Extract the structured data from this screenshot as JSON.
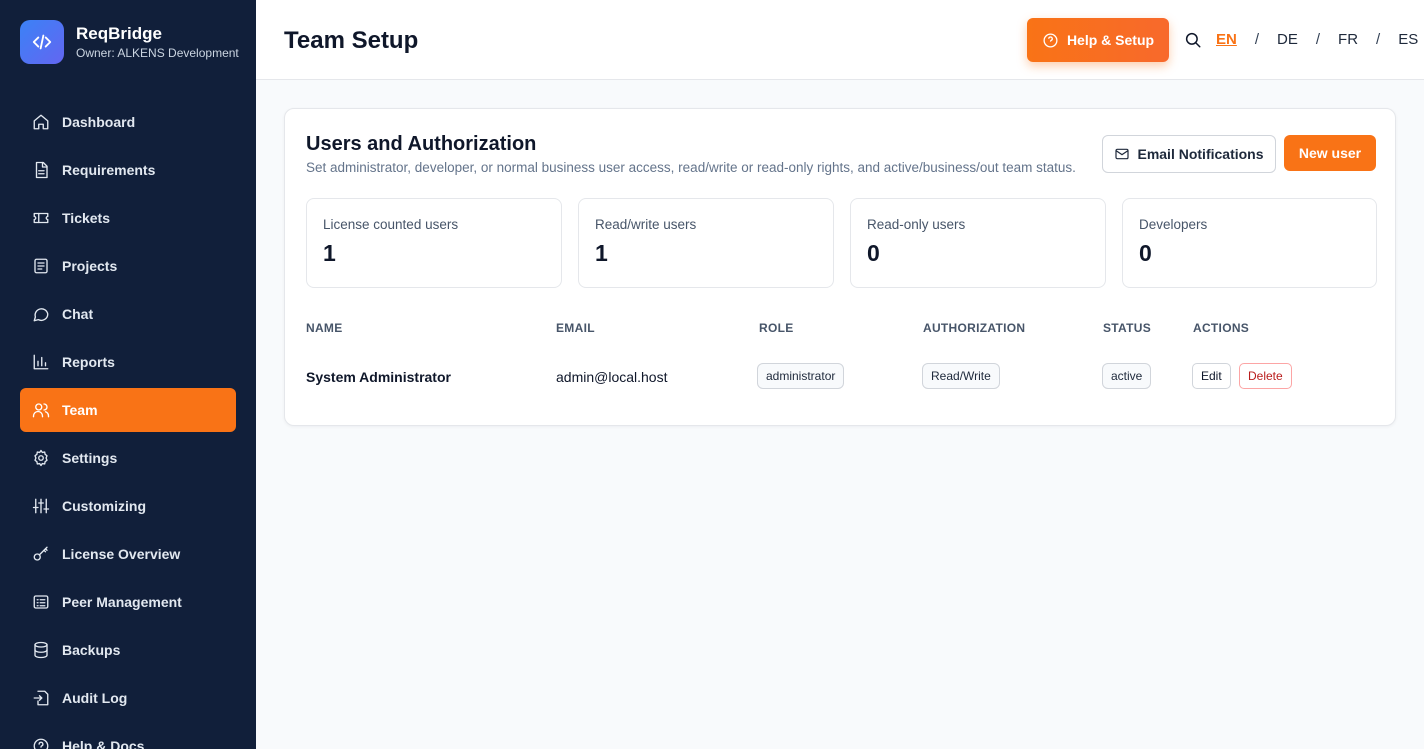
{
  "brand": {
    "name": "ReqBridge",
    "owner": "Owner: ALKENS Development",
    "logo_icon": "code-icon"
  },
  "sidebar": {
    "items": [
      {
        "label": "Dashboard",
        "icon": "home-icon",
        "active": false
      },
      {
        "label": "Requirements",
        "icon": "document-icon",
        "active": false
      },
      {
        "label": "Tickets",
        "icon": "ticket-icon",
        "active": false
      },
      {
        "label": "Projects",
        "icon": "project-icon",
        "active": false
      },
      {
        "label": "Chat",
        "icon": "chat-icon",
        "active": false
      },
      {
        "label": "Reports",
        "icon": "bar-chart-icon",
        "active": false
      },
      {
        "label": "Team",
        "icon": "users-icon",
        "active": true
      },
      {
        "label": "Settings",
        "icon": "gear-icon",
        "active": false
      },
      {
        "label": "Customizing",
        "icon": "sliders-icon",
        "active": false
      },
      {
        "label": "License Overview",
        "icon": "key-icon",
        "active": false
      },
      {
        "label": "Peer Management",
        "icon": "list-icon",
        "active": false
      },
      {
        "label": "Backups",
        "icon": "database-icon",
        "active": false
      },
      {
        "label": "Audit Log",
        "icon": "log-in-icon",
        "active": false
      },
      {
        "label": "Help & Docs",
        "icon": "help-circle-icon",
        "active": false
      }
    ]
  },
  "header": {
    "title": "Team Setup",
    "help_label": "Help & Setup",
    "languages": [
      "EN",
      "DE",
      "FR",
      "ES"
    ],
    "active_language": "EN",
    "separator": "/"
  },
  "card": {
    "title": "Users and Authorization",
    "subtitle": "Set administrator, developer, or normal business user access, read/write or read-only rights, and active/business/out team status.",
    "email_button": "Email Notifications",
    "new_button": "New user",
    "stats": [
      {
        "label": "License counted users",
        "value": "1"
      },
      {
        "label": "Read/write users",
        "value": "1"
      },
      {
        "label": "Read-only users",
        "value": "0"
      },
      {
        "label": "Developers",
        "value": "0"
      }
    ],
    "table": {
      "headers": [
        "NAME",
        "EMAIL",
        "ROLE",
        "AUTHORIZATION",
        "STATUS",
        "ACTIONS"
      ],
      "rows": [
        {
          "name": "System Administrator",
          "email": "admin@local.host",
          "role": "administrator",
          "authorization": "Read/Write",
          "status": "active",
          "edit": "Edit",
          "delete": "Delete"
        }
      ]
    }
  },
  "colors": {
    "sidebar_bg": "#111f3a",
    "accent": "#f97316",
    "danger": "#b91c1c"
  }
}
